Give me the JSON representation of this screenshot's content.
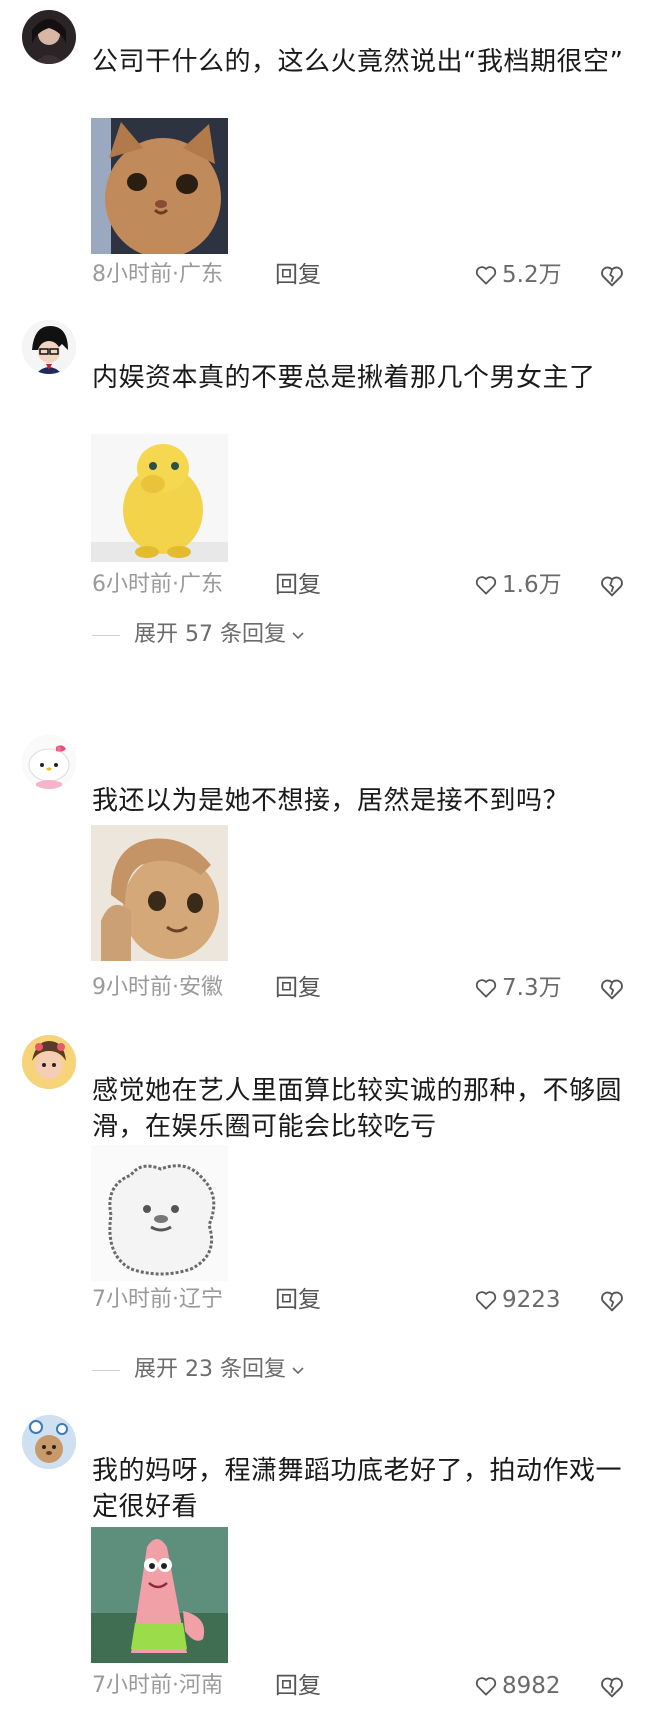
{
  "comments": [
    {
      "text": "公司干什么的，这么火竟然说出“我档期很空”",
      "meta": "8小时前·广东",
      "reply_label": "回复",
      "likes": "5.2万"
    },
    {
      "text": "内娱资本真的不要总是揪着那几个男女主了",
      "meta": "6小时前·广东",
      "reply_label": "回复",
      "likes": "1.6万",
      "expand_label": "展开 57 条回复"
    },
    {
      "text": "我还以为是她不想接，居然是接不到吗？",
      "meta": "9小时前·安徽",
      "reply_label": "回复",
      "likes": "7.3万"
    },
    {
      "text": "感觉她在艺人里面算比较实诚的那种，不够圆滑，在娱乐圈可能会比较吃亏",
      "meta": "7小时前·辽宁",
      "reply_label": "回复",
      "likes": "9223",
      "expand_label": "展开 23 条回复"
    },
    {
      "text": "我的妈呀，程潇舞蹈功底老好了，拍动作戏一定很好看",
      "meta": "7小时前·河南",
      "reply_label": "回复",
      "likes": "8982"
    }
  ],
  "icons": {
    "like": "heart-outline-icon",
    "dislike": "broken-heart-icon",
    "expand": "chevron-down-icon"
  },
  "colors": {
    "text": "#1a1a1a",
    "meta": "#9a9a9a",
    "reply": "#555555"
  }
}
